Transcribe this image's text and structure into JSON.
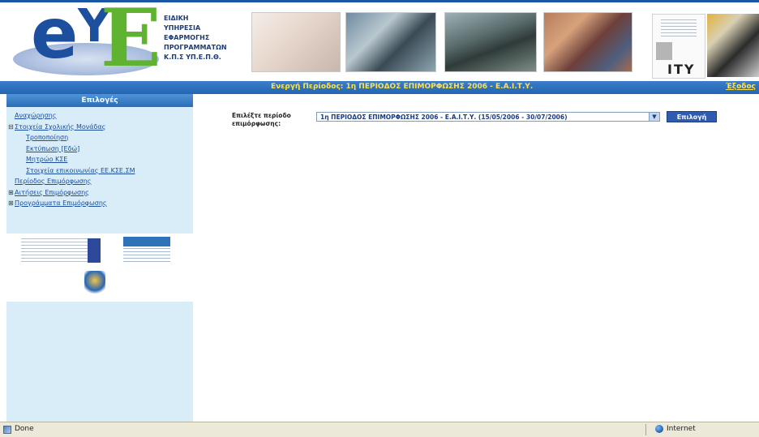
{
  "header": {
    "logo_e": "e",
    "logo_y": "Y",
    "logo_E": "E",
    "logo_text_lines": [
      "ΕΙΔΙΚΗ",
      "ΥΠΗΡΕΣΙΑ",
      "ΕΦΑΡΜΟΓΗΣ",
      "ΠΡΟΓΡΑΜΜΑΤΩΝ",
      "Κ.Π.Σ Υπ.Ε.Π.Θ."
    ],
    "ity_text": "ITY"
  },
  "topbar": {
    "active_period": "Ενεργή Περίοδος: 1η ΠΕΡΙΟΔΟΣ ΕΠΙΜΟΡΦΩΣΗΣ 2006 - Ε.Α.Ι.Τ.Υ.",
    "exit_label": "Έξοδος"
  },
  "sidebar": {
    "title": "Επιλογές",
    "items": [
      {
        "label": "Αναχώρησης",
        "sign": "",
        "level": 0
      },
      {
        "label": "Στοιχεία Σχολικής Μονάδας",
        "sign": "⊟",
        "level": 0
      },
      {
        "label": "Τροποποίηση",
        "sign": "",
        "level": 1
      },
      {
        "label": "Εκτύπωση [Εδώ]",
        "sign": "",
        "level": 1
      },
      {
        "label": "Μητρώο ΚΣΕ",
        "sign": "",
        "level": 1
      },
      {
        "label": "Στοιχεία επικοινωνίας ΕΕ.ΚΣΕ.ΣΜ",
        "sign": "",
        "level": 1
      },
      {
        "label": "Περίοδος Επιμόρφωσης",
        "sign": "",
        "level": 0
      },
      {
        "label": "Αιτήσεις Επιμόρφωσης",
        "sign": "⊞",
        "level": 0
      },
      {
        "label": "Προγράμματα Επιμόρφωσης",
        "sign": "⊞",
        "level": 0
      }
    ]
  },
  "form": {
    "label": "Επιλέξτε περίοδο επιμόρφωσης:",
    "selected_period": "1η ΠΕΡΙΟΔΟΣ ΕΠΙΜΟΡΦΩΣΗΣ 2006 - Ε.Α.Ι.Τ.Υ. (15/05/2006 - 30/07/2006)",
    "button_label": "Επιλογή"
  },
  "statusbar": {
    "status": "Done",
    "zone": "Internet"
  },
  "colors": {
    "topbar_blue": "#2366b3",
    "sidebar_bg": "#d9edf8",
    "topbar_text": "#ffe14a",
    "logo_blue": "#1d4f9f",
    "logo_green": "#5fb331"
  }
}
